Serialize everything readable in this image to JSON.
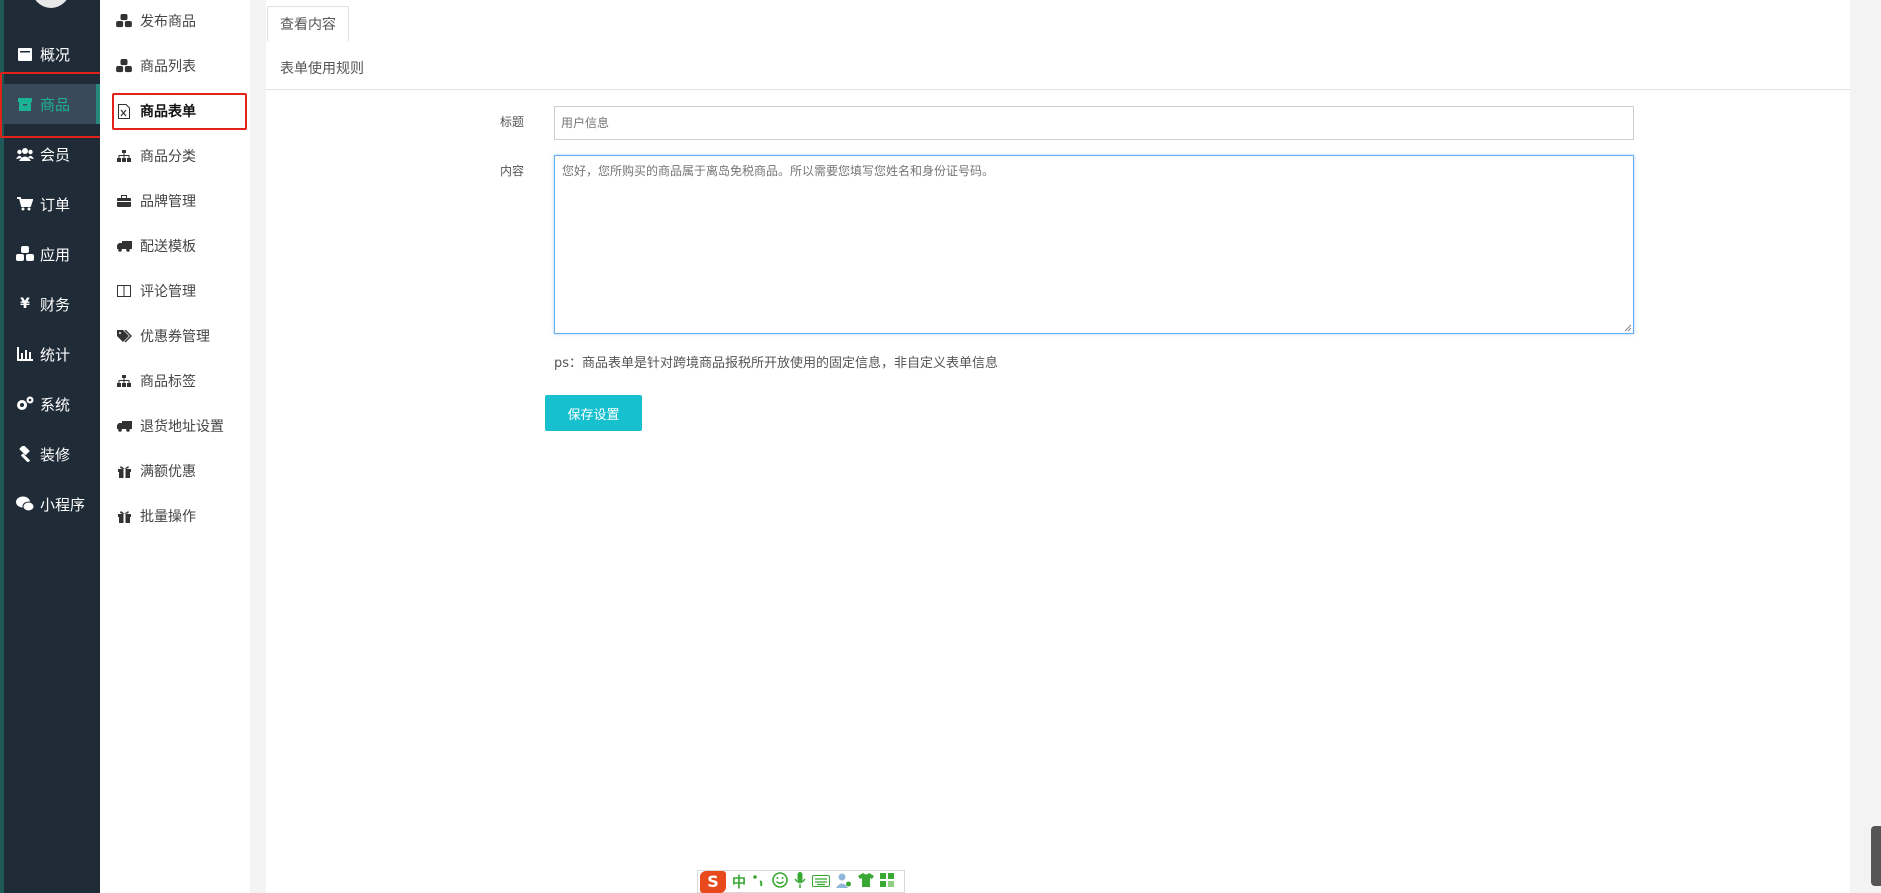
{
  "nav": {
    "items": [
      {
        "label": "概况",
        "icon": "dashboard-icon"
      },
      {
        "label": "商品",
        "icon": "goods-icon",
        "active": true
      },
      {
        "label": "会员",
        "icon": "users-icon"
      },
      {
        "label": "订单",
        "icon": "cart-icon"
      },
      {
        "label": "应用",
        "icon": "cubes-icon"
      },
      {
        "label": "财务",
        "icon": "yen-icon"
      },
      {
        "label": "统计",
        "icon": "bar-chart-icon"
      },
      {
        "label": "系统",
        "icon": "gears-icon"
      },
      {
        "label": "装修",
        "icon": "hammer-icon"
      },
      {
        "label": "小程序",
        "icon": "wechat-icon"
      }
    ]
  },
  "submenu": {
    "items": [
      {
        "label": "发布商品",
        "icon": "cubes-icon"
      },
      {
        "label": "商品列表",
        "icon": "cubes-icon"
      },
      {
        "label": "商品表单",
        "icon": "excel-file-icon",
        "active": true
      },
      {
        "label": "商品分类",
        "icon": "sitemap-icon"
      },
      {
        "label": "品牌管理",
        "icon": "briefcase-icon"
      },
      {
        "label": "配送模板",
        "icon": "truck-icon"
      },
      {
        "label": "评论管理",
        "icon": "columns-icon"
      },
      {
        "label": "优惠券管理",
        "icon": "tags-icon"
      },
      {
        "label": "商品标签",
        "icon": "sitemap-icon"
      },
      {
        "label": "退货地址设置",
        "icon": "truck-icon"
      },
      {
        "label": "满额优惠",
        "icon": "gift-icon"
      },
      {
        "label": "批量操作",
        "icon": "gift-icon"
      }
    ]
  },
  "main": {
    "tab": "查看内容",
    "section_title": "表单使用规则",
    "form": {
      "title_label": "标题",
      "title_placeholder": "用户信息",
      "content_label": "内容",
      "content_placeholder": "您好，您所购买的商品属于离岛免税商品。所以需要您填写您姓名和身份证号码。",
      "note": "ps：商品表单是针对跨境商品报税所开放使用的固定信息，非自定义表单信息",
      "save_label": "保存设置"
    }
  },
  "ime": {
    "logo": "S",
    "mode": "中"
  },
  "colors": {
    "nav_bg": "#1f2b37",
    "accent": "#1ab394",
    "button": "#17c0cf",
    "highlight_box": "#e2231a"
  }
}
